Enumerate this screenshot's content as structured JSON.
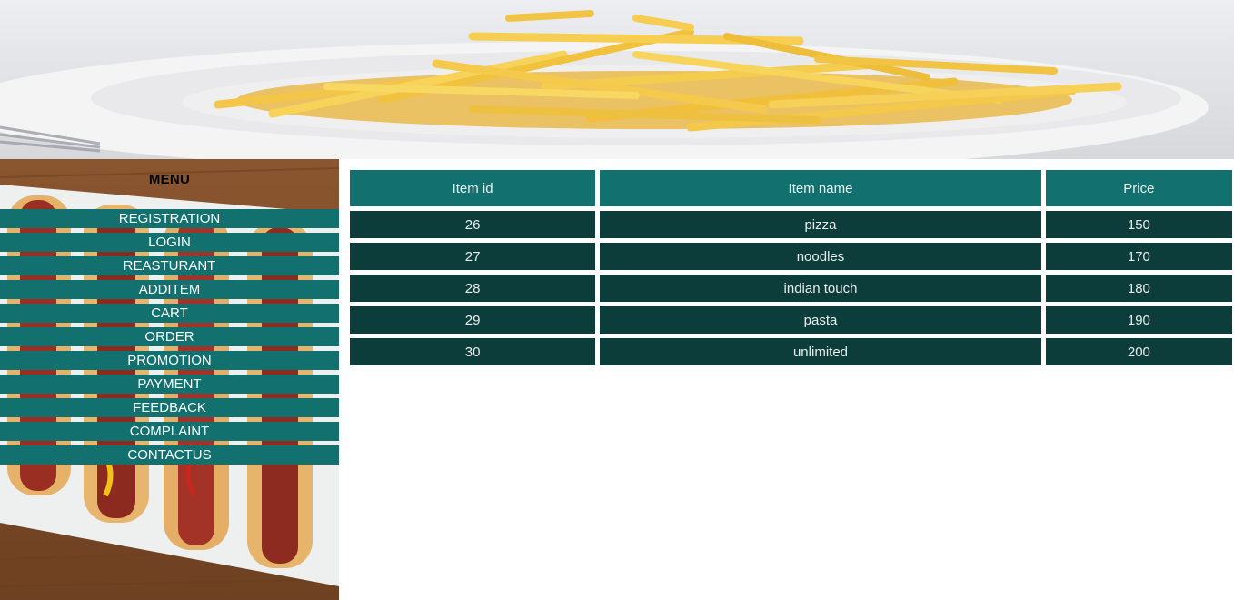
{
  "banner": {
    "image": "fries-on-plate-photo"
  },
  "sidebar": {
    "background": "hotdogs-on-wood-photo",
    "title": "MENU",
    "items": [
      {
        "label": "REGISTRATION"
      },
      {
        "label": "LOGIN"
      },
      {
        "label": "REASTURANT"
      },
      {
        "label": "ADDITEM"
      },
      {
        "label": "CART"
      },
      {
        "label": "ORDER"
      },
      {
        "label": "PROMOTION"
      },
      {
        "label": "PAYMENT"
      },
      {
        "label": "FEEDBACK"
      },
      {
        "label": "COMPLAINT"
      },
      {
        "label": "CONTACTUS"
      }
    ]
  },
  "table": {
    "headers": [
      "Item id",
      "Item name",
      "Price"
    ],
    "rows": [
      [
        "26",
        "pizza",
        "150"
      ],
      [
        "27",
        "noodles",
        "170"
      ],
      [
        "28",
        "indian touch",
        "180"
      ],
      [
        "29",
        "pasta",
        "190"
      ],
      [
        "30",
        "unlimited",
        "200"
      ]
    ]
  },
  "colors": {
    "menu_item_bg": "#12716f",
    "header_cell_bg": "#12716f",
    "body_cell_bg": "#0c3d3b"
  }
}
